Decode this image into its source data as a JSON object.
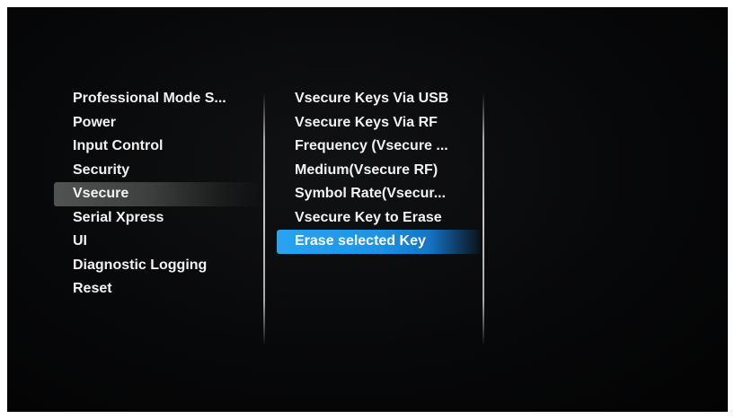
{
  "menu_left": {
    "items": [
      {
        "label": "Professional Mode S..."
      },
      {
        "label": "Power"
      },
      {
        "label": "Input Control"
      },
      {
        "label": "Security"
      },
      {
        "label": "Vsecure",
        "selected": true
      },
      {
        "label": "Serial Xpress"
      },
      {
        "label": "UI"
      },
      {
        "label": "Diagnostic Logging"
      },
      {
        "label": "Reset"
      }
    ]
  },
  "menu_sub": {
    "items": [
      {
        "label": "Vsecure Keys Via USB"
      },
      {
        "label": "Vsecure Keys Via RF"
      },
      {
        "label": "Frequency (Vsecure ..."
      },
      {
        "label": "Medium(Vsecure RF)"
      },
      {
        "label": "Symbol Rate(Vsecur..."
      },
      {
        "label": "Vsecure Key to Erase"
      },
      {
        "label": "Erase selected Key",
        "focused": true
      }
    ]
  },
  "colors": {
    "focus_highlight": "#1e93e4",
    "parent_highlight": "#4f5351",
    "text": "#f2f2f2",
    "background": "#07080a"
  }
}
